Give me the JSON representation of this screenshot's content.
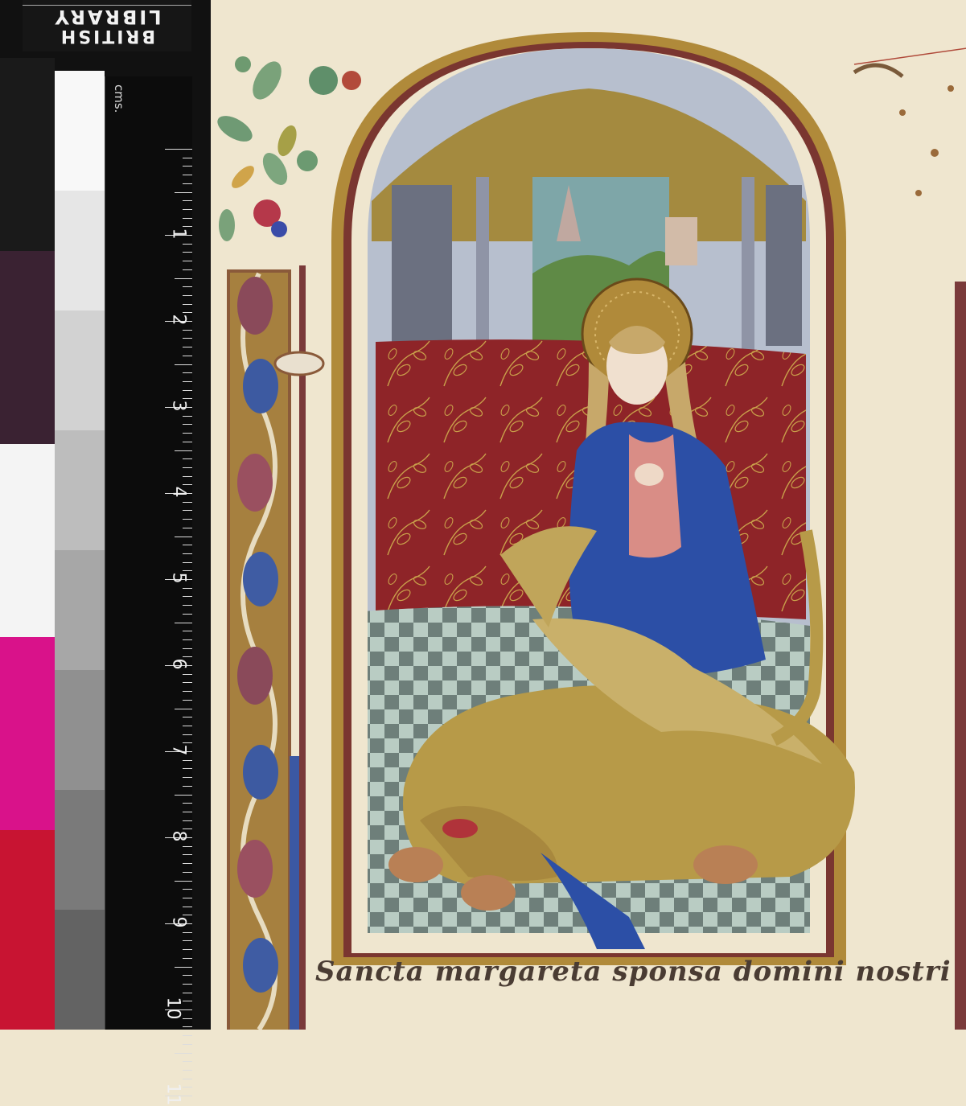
{
  "watermark": {
    "line1": "BRITISH",
    "line2": "LIBRARY"
  },
  "ruler": {
    "unit_label": "cms.",
    "numbers": [
      "1",
      "2",
      "3",
      "4",
      "5",
      "6",
      "7",
      "8",
      "9",
      "10",
      "11"
    ]
  },
  "color_chart": {
    "swatches": [
      "#1a1a1a",
      "#3a2232",
      "#f4f4f4",
      "#d9128a",
      "#c81432"
    ],
    "grays": [
      "#f8f8f8",
      "#e6e6e6",
      "#d2d2d2",
      "#bdbdbd",
      "#a7a7a7",
      "#909090",
      "#7a7a7a",
      "#636363"
    ]
  },
  "manuscript": {
    "caption": "Sancta margareta sponsa domini nostri"
  },
  "palette": {
    "parchment": "#efe6cf",
    "gold": "#b08a3a",
    "red_hanging": "#8e2428",
    "blue_robe": "#2c4fa6",
    "dragon": "#b79a48",
    "tile_light": "#b9ccc3",
    "tile_dark": "#6e7f7a"
  }
}
